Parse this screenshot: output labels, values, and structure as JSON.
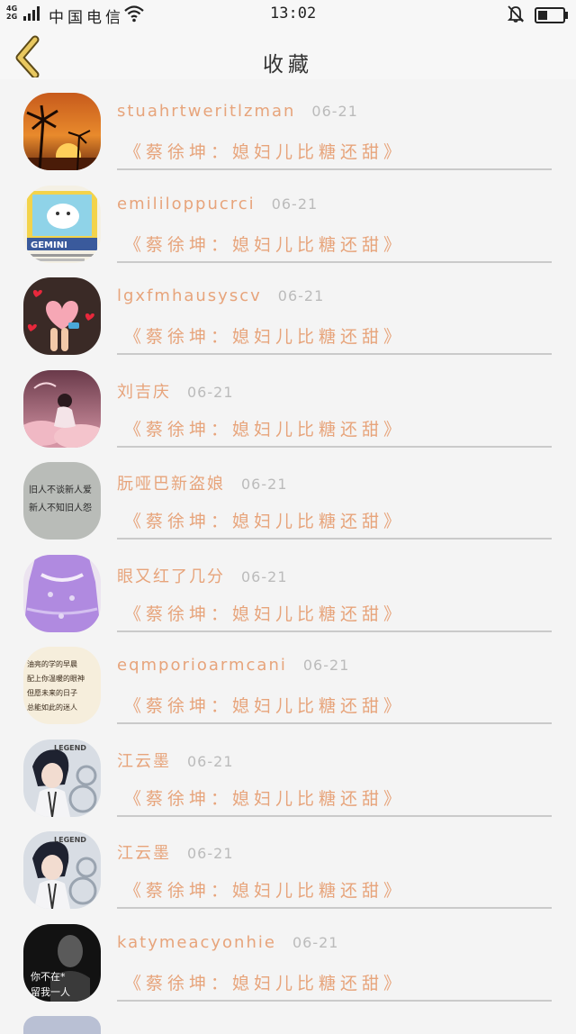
{
  "status_bar": {
    "net_top": "4G",
    "net_bottom": "2G",
    "carrier": "中国电信",
    "time": "13:02"
  },
  "header": {
    "title": "收藏"
  },
  "items": [
    {
      "user": "stuahrtweritlzman",
      "date": "06-21",
      "title": "《蔡徐坤：媳妇儿比糖还甜》"
    },
    {
      "user": "emililoppucrci",
      "date": "06-21",
      "title": "《蔡徐坤：媳妇儿比糖还甜》"
    },
    {
      "user": "lgxfmhausyscv",
      "date": "06-21",
      "title": "《蔡徐坤：媳妇儿比糖还甜》"
    },
    {
      "user": "刘吉庆",
      "date": "06-21",
      "title": "《蔡徐坤：媳妇儿比糖还甜》"
    },
    {
      "user": "朊哑巴新盗娘",
      "date": "06-21",
      "title": "《蔡徐坤：媳妇儿比糖还甜》"
    },
    {
      "user": "眼又红了几分",
      "date": "06-21",
      "title": "《蔡徐坤：媳妇儿比糖还甜》"
    },
    {
      "user": "eqmporioarmcani",
      "date": "06-21",
      "title": "《蔡徐坤：媳妇儿比糖还甜》"
    },
    {
      "user": "江云墨",
      "date": "06-21",
      "title": "《蔡徐坤：媳妇儿比糖还甜》"
    },
    {
      "user": "江云墨",
      "date": "06-21",
      "title": "《蔡徐坤：媳妇儿比糖还甜》"
    },
    {
      "user": "katymeacyonhie",
      "date": "06-21",
      "title": "《蔡徐坤：媳妇儿比糖还甜》"
    }
  ],
  "avatar_texts": {
    "a2_brand": "GEMINI",
    "a5_line1": "旧人不谈新人爱",
    "a5_line2": "新人不知旧人怨",
    "a7_line1": "油亮的学的早晨",
    "a7_line2": "配上你温暖的眼神",
    "a7_line3": "但愿未来的日子",
    "a7_line4": "总能如此的迷人",
    "a8_brand": "LEGEND",
    "a9_brand": "LEGEND",
    "a10_line1": "你不在*",
    "a10_line2": "留我一人"
  },
  "colors": {
    "accent_text": "#e7a47b",
    "date_text": "#bbbbbb",
    "divider": "#cacaca",
    "back_arrow": "#e8c860"
  }
}
